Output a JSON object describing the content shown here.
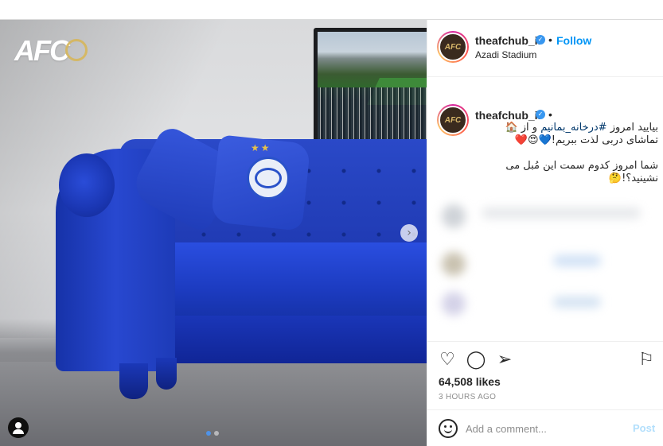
{
  "media": {
    "logo_text": "AFC",
    "carousel": {
      "total": 2,
      "current": 1
    }
  },
  "header": {
    "username": "theafchub_ir",
    "separator": "•",
    "follow_label": "Follow",
    "location": "Azadi Stadium"
  },
  "caption": {
    "username": "theafchub_ir",
    "separator": "•",
    "line1_a": "بیایید امروز ",
    "line1_hashtag": "#در‌خانه_بمانیم",
    "line1_b": " و از ",
    "line1_emoji": "🏠",
    "line2_text": "تماشای دربی لذت ببریم!",
    "line2_emojis": "💙😍❤️",
    "line3": "شما امروز کدوم سمت این مُبل می",
    "line4_text": "نشینید؟!",
    "line4_emoji": "🤔"
  },
  "actions": {
    "like_icon": "heart-icon",
    "comment_icon": "comment-icon",
    "share_icon": "share-icon",
    "save_icon": "bookmark-icon",
    "likes": "64,508 likes",
    "time": "3 HOURS AGO"
  },
  "comment_box": {
    "placeholder": "Add a comment...",
    "post_label": "Post"
  },
  "colors": {
    "accent": "#0095f6",
    "post_disabled": "#b2dffc",
    "sofa": "#1e38b0",
    "verified": "#3897f0"
  }
}
